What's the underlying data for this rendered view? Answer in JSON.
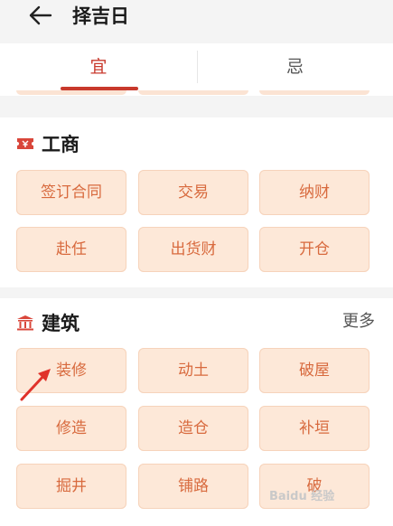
{
  "header": {
    "title": "择吉日"
  },
  "tabs": [
    {
      "label": "宜",
      "active": true
    },
    {
      "label": "忌",
      "active": false
    }
  ],
  "sections": {
    "gongshang": {
      "title": "工商",
      "items": [
        "签订合同",
        "交易",
        "纳财",
        "赴任",
        "出货财",
        "开仓"
      ]
    },
    "jianzhu": {
      "title": "建筑",
      "more": "更多",
      "items": [
        "装修",
        "动土",
        "破屋",
        "修造",
        "造仓",
        "补垣",
        "掘井",
        "铺路",
        "破"
      ]
    }
  },
  "watermark": "Baidu 经验",
  "colors": {
    "accent": "#c8392c",
    "chip_bg": "#fde8d8",
    "chip_text": "#d86a3e"
  }
}
